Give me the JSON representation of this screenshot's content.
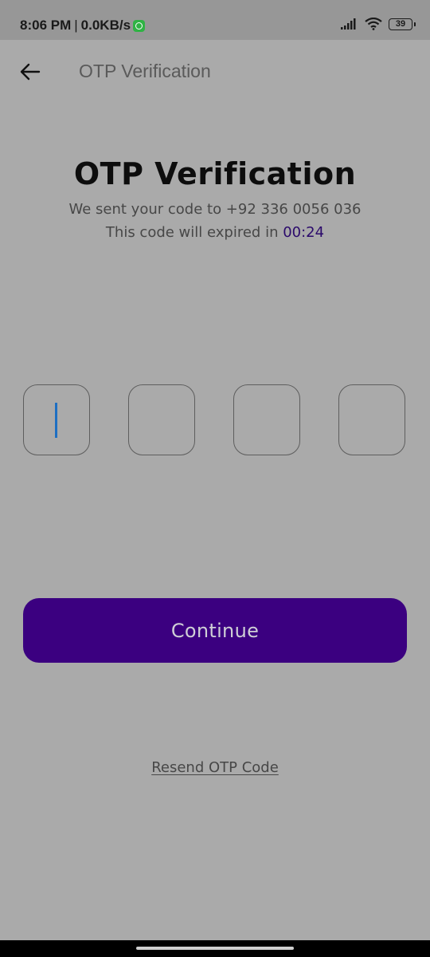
{
  "status_bar": {
    "time": "8:06 PM",
    "separator": "|",
    "network_speed": "0.0KB/s",
    "notification_icon": "whatsapp-icon",
    "signal_icon": "signal-icon",
    "wifi_icon": "wifi-icon",
    "battery_level": "39"
  },
  "app_bar": {
    "back_icon": "arrow-left-icon",
    "title": "OTP Verification"
  },
  "header": {
    "title": "OTP Verification",
    "sent_prefix": "We sent your code to ",
    "phone": "+92 336 0056 036",
    "expiry_prefix": "This code will expired in ",
    "timer": "00:24",
    "timer_color": "#2b0a6b"
  },
  "otp": {
    "digits": [
      "",
      "",
      "",
      ""
    ],
    "focused_index": 0
  },
  "actions": {
    "continue_label": "Continue",
    "resend_label": "Resend OTP Code",
    "button_color": "#3b0080"
  }
}
